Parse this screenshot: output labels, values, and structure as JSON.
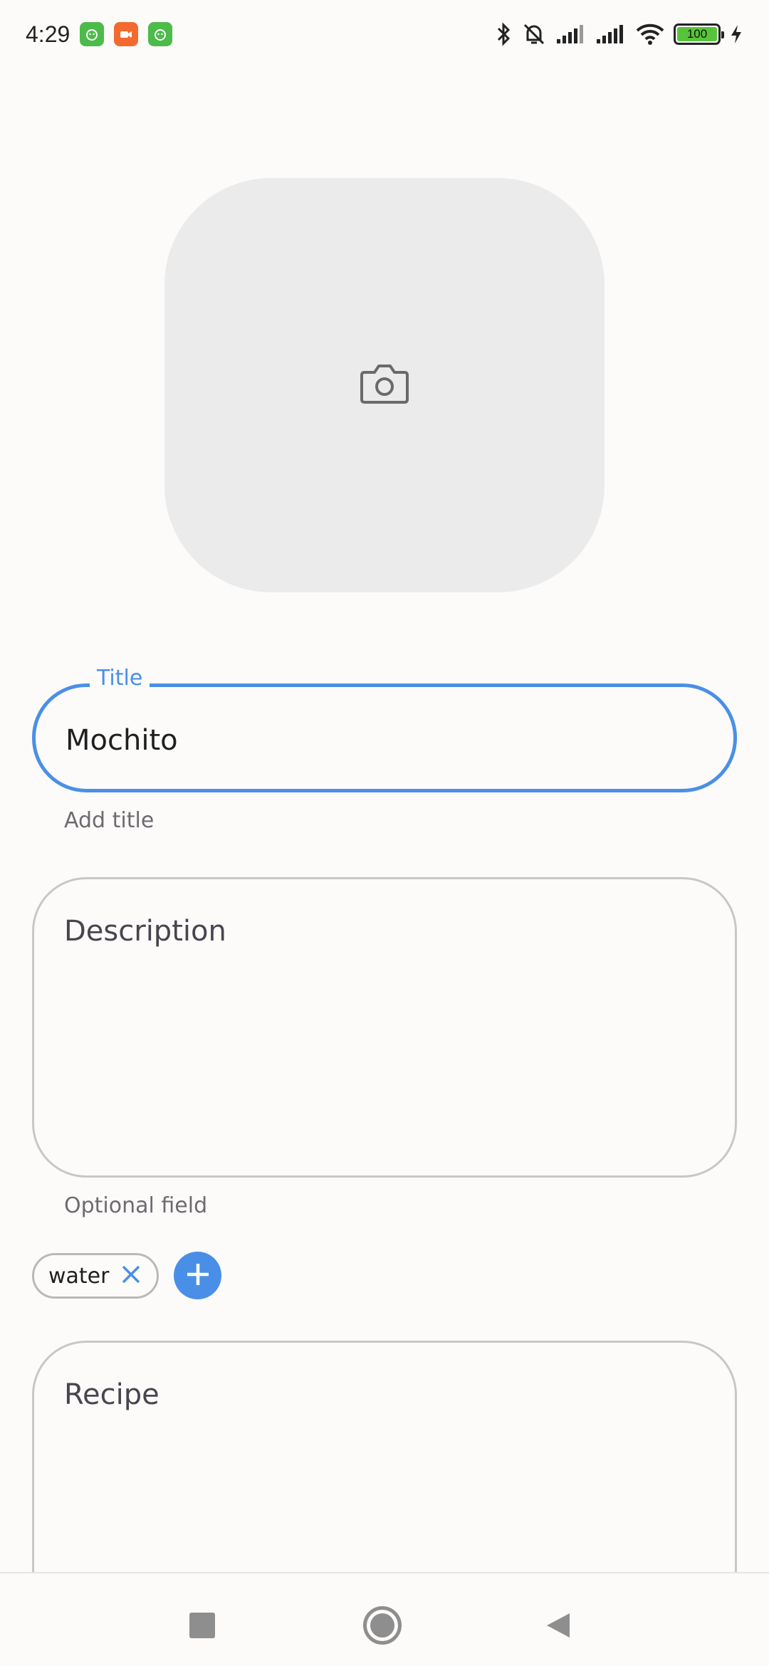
{
  "status_bar": {
    "time": "4:29",
    "battery": "100",
    "icons": [
      "bluetooth-icon",
      "bell-off-icon",
      "signal-icon",
      "signal-icon",
      "wifi-icon",
      "battery-icon",
      "charging-icon"
    ]
  },
  "image_picker": {
    "icon": "camera-icon"
  },
  "title_field": {
    "label": "Title",
    "value": "Mochito",
    "helper": "Add title"
  },
  "description_field": {
    "placeholder": "Description",
    "helper": "Optional field"
  },
  "tags": {
    "chips": [
      {
        "label": "water"
      }
    ],
    "add_icon": "plus-icon"
  },
  "recipe_field": {
    "placeholder": "Recipe"
  },
  "colors": {
    "accent": "#4a8fe7",
    "outline": "#cbc5c8",
    "background": "#fcfbfa"
  }
}
